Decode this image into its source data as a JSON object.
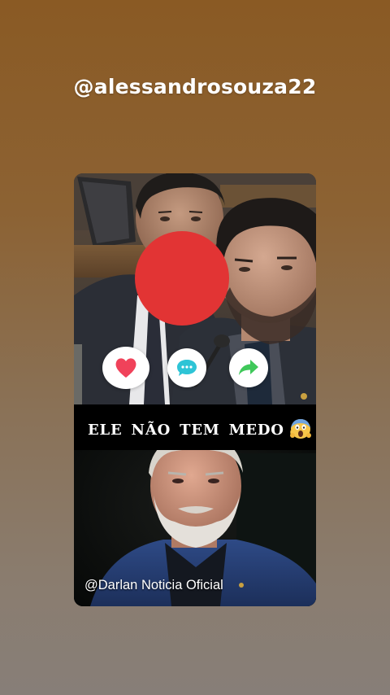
{
  "header": {
    "username": "@alessandrosouza22"
  },
  "post": {
    "caption": "ELE NÃO TEM MEDO",
    "caption_emoji": "face-screaming-in-fear-icon",
    "watermark": "@Darlan Noticia Oficial"
  },
  "actions": [
    {
      "name": "like-button",
      "icon": "heart-icon",
      "color": "#f0425a"
    },
    {
      "name": "comment-button",
      "icon": "chat-bubble-icon",
      "color": "#2ec4d6"
    },
    {
      "name": "share-button",
      "icon": "share-arrow-icon",
      "color": "#3fc85a"
    }
  ],
  "colors": {
    "record_dot": "#e23434",
    "background_top": "#8a5a24",
    "background_bottom": "#877e78"
  }
}
